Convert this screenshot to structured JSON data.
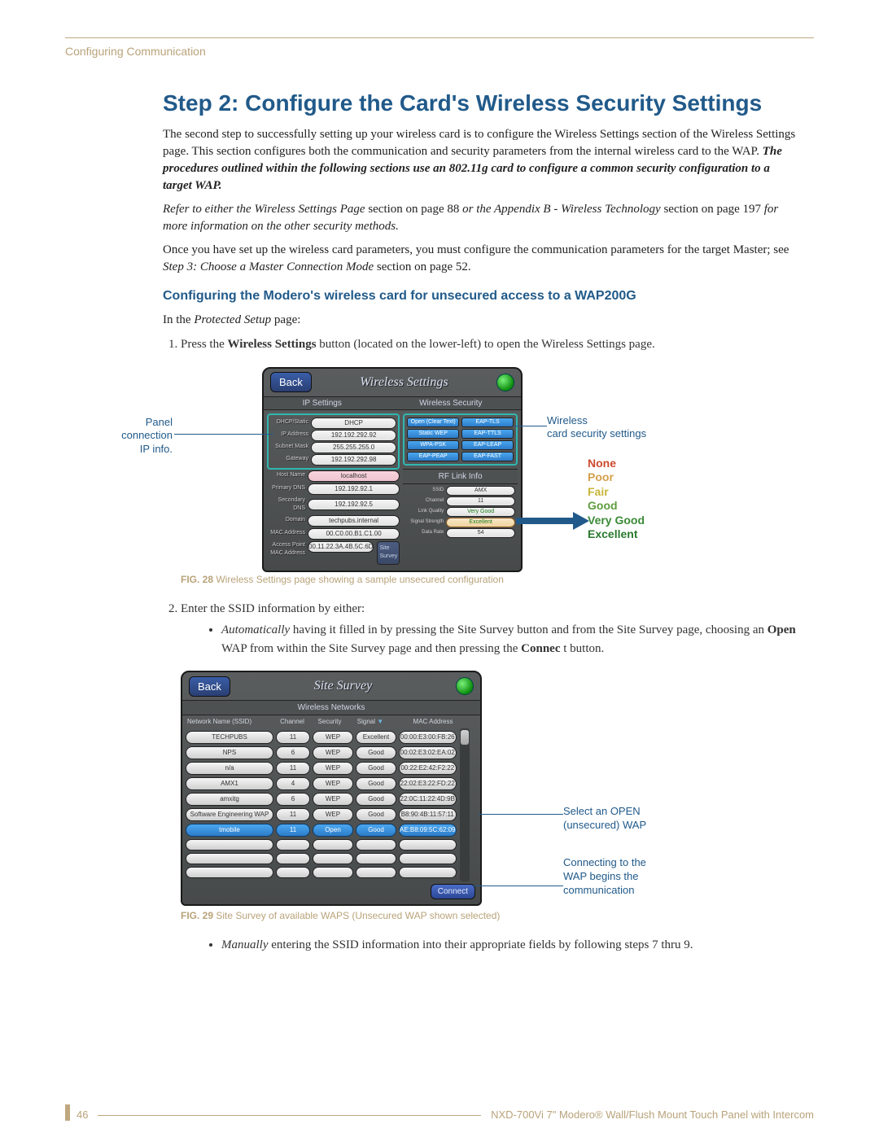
{
  "header": {
    "section": "Configuring Communication"
  },
  "title": "Step 2: Configure the Card's Wireless Security Settings",
  "para1_a": "The second step to successfully setting up your wireless card is to configure the Wireless Settings section of the Wireless Settings page. This section configures both the communication and security parameters from the internal wireless card to the WAP. ",
  "para1_b": "The procedures outlined within the following sections use an 802.11g card to configure a common security configuration to a target WAP.",
  "para2_a": "Refer to either the Wireless Settings Page",
  "para2_b": " section on page 88 ",
  "para2_c": "or the Appendix B - Wireless Technology",
  "para2_d": " section on page 197 ",
  "para2_e": "for more information on the other security methods.",
  "para3_a": "Once you have set up the wireless card parameters, you must configure the communication parameters for the target Master; see ",
  "para3_b": "Step 3: Choose a Master Connection Mode",
  "para3_c": " section on page 52.",
  "subheading1": "Configuring the Modero's wireless card for unsecured access to a WAP200G",
  "prelist": "In the",
  "prelist_i": " Protected Setup",
  "prelist_b": " page:",
  "step1_a": "Press the ",
  "step1_b": "Wireless Settings",
  "step1_c": " button (located on the lower-left) to open the Wireless Settings page.",
  "fig28": {
    "callout_left": "Panel\nconnection\nIP info.",
    "callout_right": "Wireless\ncard security settings",
    "panel": {
      "back": "Back",
      "title": "Wireless Settings",
      "tab_l": "IP Settings",
      "tab_r": "Wireless Security",
      "sub_rf": "RF Link Info",
      "ip": {
        "dhcp_l": "DHCP/Static",
        "dhcp": "DHCP",
        "ipaddr_l": "IP Address",
        "ipaddr": "192.192.292.92",
        "subnet_l": "Subnet Mask",
        "subnet": "255.255.255.0",
        "gateway_l": "Gateway",
        "gateway": "192.192.292.98",
        "hostname_l": "Host Name",
        "hostname": "localhost",
        "pridns_l": "Primary DNS",
        "pridns": "192.192.92.1",
        "secdns_l": "Secondary DNS",
        "secdns": "192.192.92.5",
        "domain_l": "Domain",
        "domain": "techpubs.internal",
        "mac_l": "MAC Address",
        "mac": "00.C0.00.B1.C1.00",
        "apmac_l": "Access Point\nMAC Address",
        "apmac": "00.11.22.3A.4B.5C.6D",
        "site": "Site\nSurvey"
      },
      "sec_left": [
        "Open (Clear Text)",
        "Static WEP",
        "WPA-PSK",
        "EAP-PEAP"
      ],
      "sec_right": [
        "EAP-TLS",
        "EAP-TTLS",
        "EAP-LEAP",
        "EAP-FAST"
      ],
      "rf": {
        "ssid_l": "SSID",
        "ssid": "AMX",
        "chan_l": "Channel",
        "chan": "11",
        "quality_l": "Link Quality",
        "quality": "Very Good",
        "signal_l": "Signal Strength",
        "signal": "Excellent",
        "rate_l": "Data Rate",
        "rate": "54"
      }
    },
    "quality_list": [
      "None",
      "Poor",
      "Fair",
      "Good",
      "Very Good",
      "Excellent"
    ],
    "caption_b": "FIG. 28 ",
    "caption": "Wireless Settings page showing a sample unsecured configuration"
  },
  "step2": "Enter the SSID information by either:",
  "bullet1_a": "Automatically",
  "bullet1_b": " having it filled in by pressing the Site Survey button and from the Site Survey page, choosing an ",
  "bullet1_c": "Open",
  "bullet1_d": " WAP from within the Site Survey page and then pressing the ",
  "bullet1_e": "Connec",
  "bullet1_f": "t button.",
  "fig29": {
    "callout_r1": "Select an OPEN\n(unsecured) WAP",
    "callout_r2": "Connecting to the\nWAP begins the\ncommunication",
    "panel": {
      "back": "Back",
      "title": "Site Survey",
      "subtitle": "Wireless Networks",
      "cols": {
        "name": "Network Name (SSID)",
        "chan": "Channel",
        "sec": "Security",
        "sig": "Signal",
        "mac": "MAC Address"
      },
      "rows": [
        {
          "name": "TECHPUBS",
          "chan": "11",
          "sec": "WEP",
          "sig": "Excellent",
          "mac": "00:00:E3:00:FB:26"
        },
        {
          "name": "NPS",
          "chan": "6",
          "sec": "WEP",
          "sig": "Good",
          "mac": "00:02:E3:02:EA:02"
        },
        {
          "name": "n/a",
          "chan": "11",
          "sec": "WEP",
          "sig": "Good",
          "mac": "00:22:E2:42:F2:22"
        },
        {
          "name": "AMX1",
          "chan": "4",
          "sec": "WEP",
          "sig": "Good",
          "mac": "22:02:E3:22:FD:22"
        },
        {
          "name": "amxitg",
          "chan": "6",
          "sec": "WEP",
          "sig": "Good",
          "mac": "22:0C:11:22:4D:9B"
        },
        {
          "name": "Software Engineering WAP",
          "chan": "11",
          "sec": "WEP",
          "sig": "Good",
          "mac": "B8:90:4B:11:57:11"
        },
        {
          "name": "tmobile",
          "chan": "11",
          "sec": "Open",
          "sig": "Good",
          "mac": "AE:B8:09:5C:62:09"
        }
      ],
      "connect": "Connect"
    },
    "caption_b": "FIG. 29 ",
    "caption": "Site Survey of available WAPS (Unsecured WAP shown selected)"
  },
  "bullet2_a": "Manually",
  "bullet2_b": " entering the SSID information into their appropriate fields by following steps 7 thru 9.",
  "footer": {
    "page": "46",
    "doc": "NXD-700Vi 7\" Modero® Wall/Flush Mount Touch Panel with Intercom"
  }
}
